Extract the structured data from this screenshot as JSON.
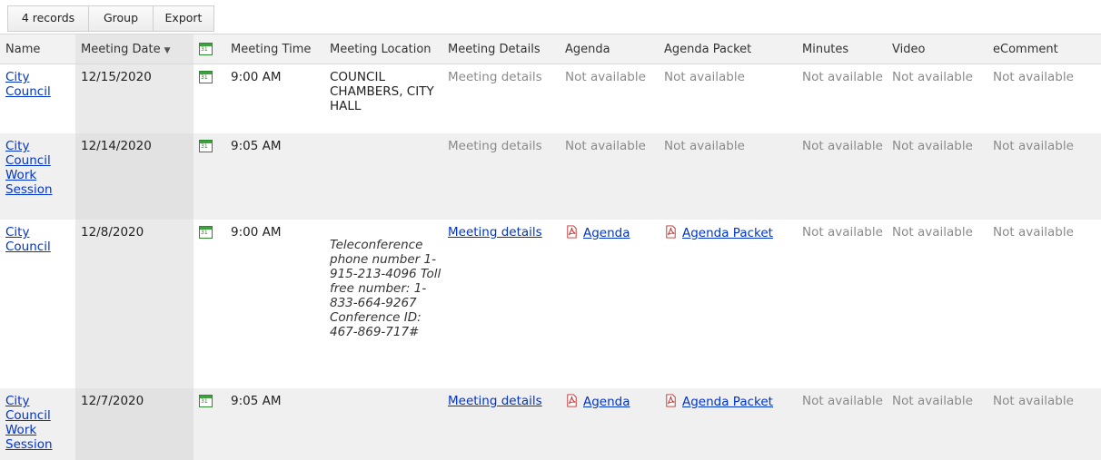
{
  "toolbar": {
    "records_label": "4 records",
    "group_label": "Group",
    "export_label": "Export"
  },
  "columns": {
    "name": "Name",
    "meeting_date": "Meeting Date",
    "sort_indicator": "▼",
    "calendar_icon_text": "31",
    "meeting_time": "Meeting Time",
    "meeting_location": "Meeting Location",
    "meeting_details": "Meeting Details",
    "agenda": "Agenda",
    "agenda_packet": "Agenda Packet",
    "minutes": "Minutes",
    "video": "Video",
    "ecomment": "eComment"
  },
  "rows": [
    {
      "name": "City Council",
      "date": "12/15/2020",
      "time": "9:00 AM",
      "location_upper": "COUNCIL CHAMBERS, CITY HALL",
      "location_note": "",
      "details": "Meeting details",
      "agenda": "Not available",
      "agenda_packet": "Not available",
      "minutes": "Not available",
      "video": "Not available",
      "ecomment": "Not available"
    },
    {
      "name": "City Council Work Session",
      "date": "12/14/2020",
      "time": "9:05 AM",
      "location_upper": "",
      "location_note": "",
      "details": "Meeting details",
      "agenda": "Not available",
      "agenda_packet": "Not available",
      "minutes": "Not available",
      "video": "Not available",
      "ecomment": "Not available"
    },
    {
      "name": "City Council",
      "date": "12/8/2020",
      "time": "9:00 AM",
      "location_upper": "",
      "location_note": "Teleconference phone number 1-915-213-4096 Toll free number: 1-833-664-9267 Conference ID: 467-869-717#",
      "details": "Meeting details",
      "agenda": "Agenda",
      "agenda_packet": "Agenda Packet",
      "minutes": "Not available",
      "video": "Not available",
      "ecomment": "Not available"
    },
    {
      "name": "City Council Work Session",
      "date": "12/7/2020",
      "time": "9:05 AM",
      "location_upper": "",
      "location_note": "",
      "details": "Meeting details",
      "agenda": "Agenda",
      "agenda_packet": "Agenda Packet",
      "minutes": "Not available",
      "video": "Not available",
      "ecomment": "Not available"
    }
  ]
}
